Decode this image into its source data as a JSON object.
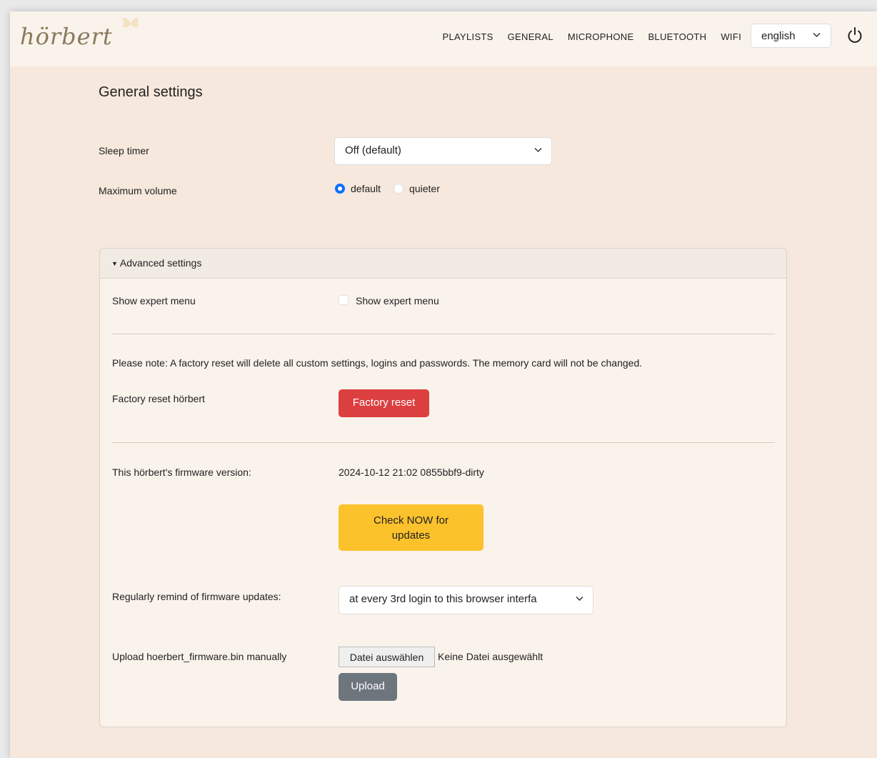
{
  "brand": {
    "logo_text": "hörbert"
  },
  "nav": {
    "items": [
      "PLAYLISTS",
      "GENERAL",
      "MICROPHONE",
      "BLUETOOTH",
      "WIFI"
    ],
    "language": "english"
  },
  "general": {
    "title": "General settings",
    "sleep_timer_label": "Sleep timer",
    "sleep_timer_value": "Off (default)",
    "max_volume_label": "Maximum volume",
    "volume_options": [
      {
        "label": "default",
        "selected": true
      },
      {
        "label": "quieter",
        "selected": false
      }
    ]
  },
  "advanced": {
    "header": "Advanced settings",
    "expert_menu_label": "Show expert menu",
    "expert_menu_checkbox_label": "Show expert menu",
    "expert_menu_checked": false,
    "reset_note": "Please note: A factory reset will delete all custom settings, logins and passwords. The memory card will not be changed.",
    "factory_reset_label": "Factory reset hörbert",
    "factory_reset_button": "Factory reset",
    "firmware_label": "This hörbert's firmware version:",
    "firmware_version": "2024-10-12 21:02 0855bbf9-dirty",
    "check_updates_button": "Check NOW for updates",
    "remind_label": "Regularly remind of firmware updates:",
    "remind_value": "at every 3rd login to this browser interfa",
    "upload_label": "Upload hoerbert_firmware.bin manually",
    "choose_file_button": "Datei auswählen",
    "no_file_text": "Keine Datei ausgewählt",
    "upload_button": "Upload"
  },
  "colors": {
    "background": "#f6e8dc",
    "navbar": "#faf3ec",
    "danger": "#dc3f3f",
    "warning": "#fbc22c",
    "secondary": "#6d757d",
    "primary": "#0d6efd"
  }
}
